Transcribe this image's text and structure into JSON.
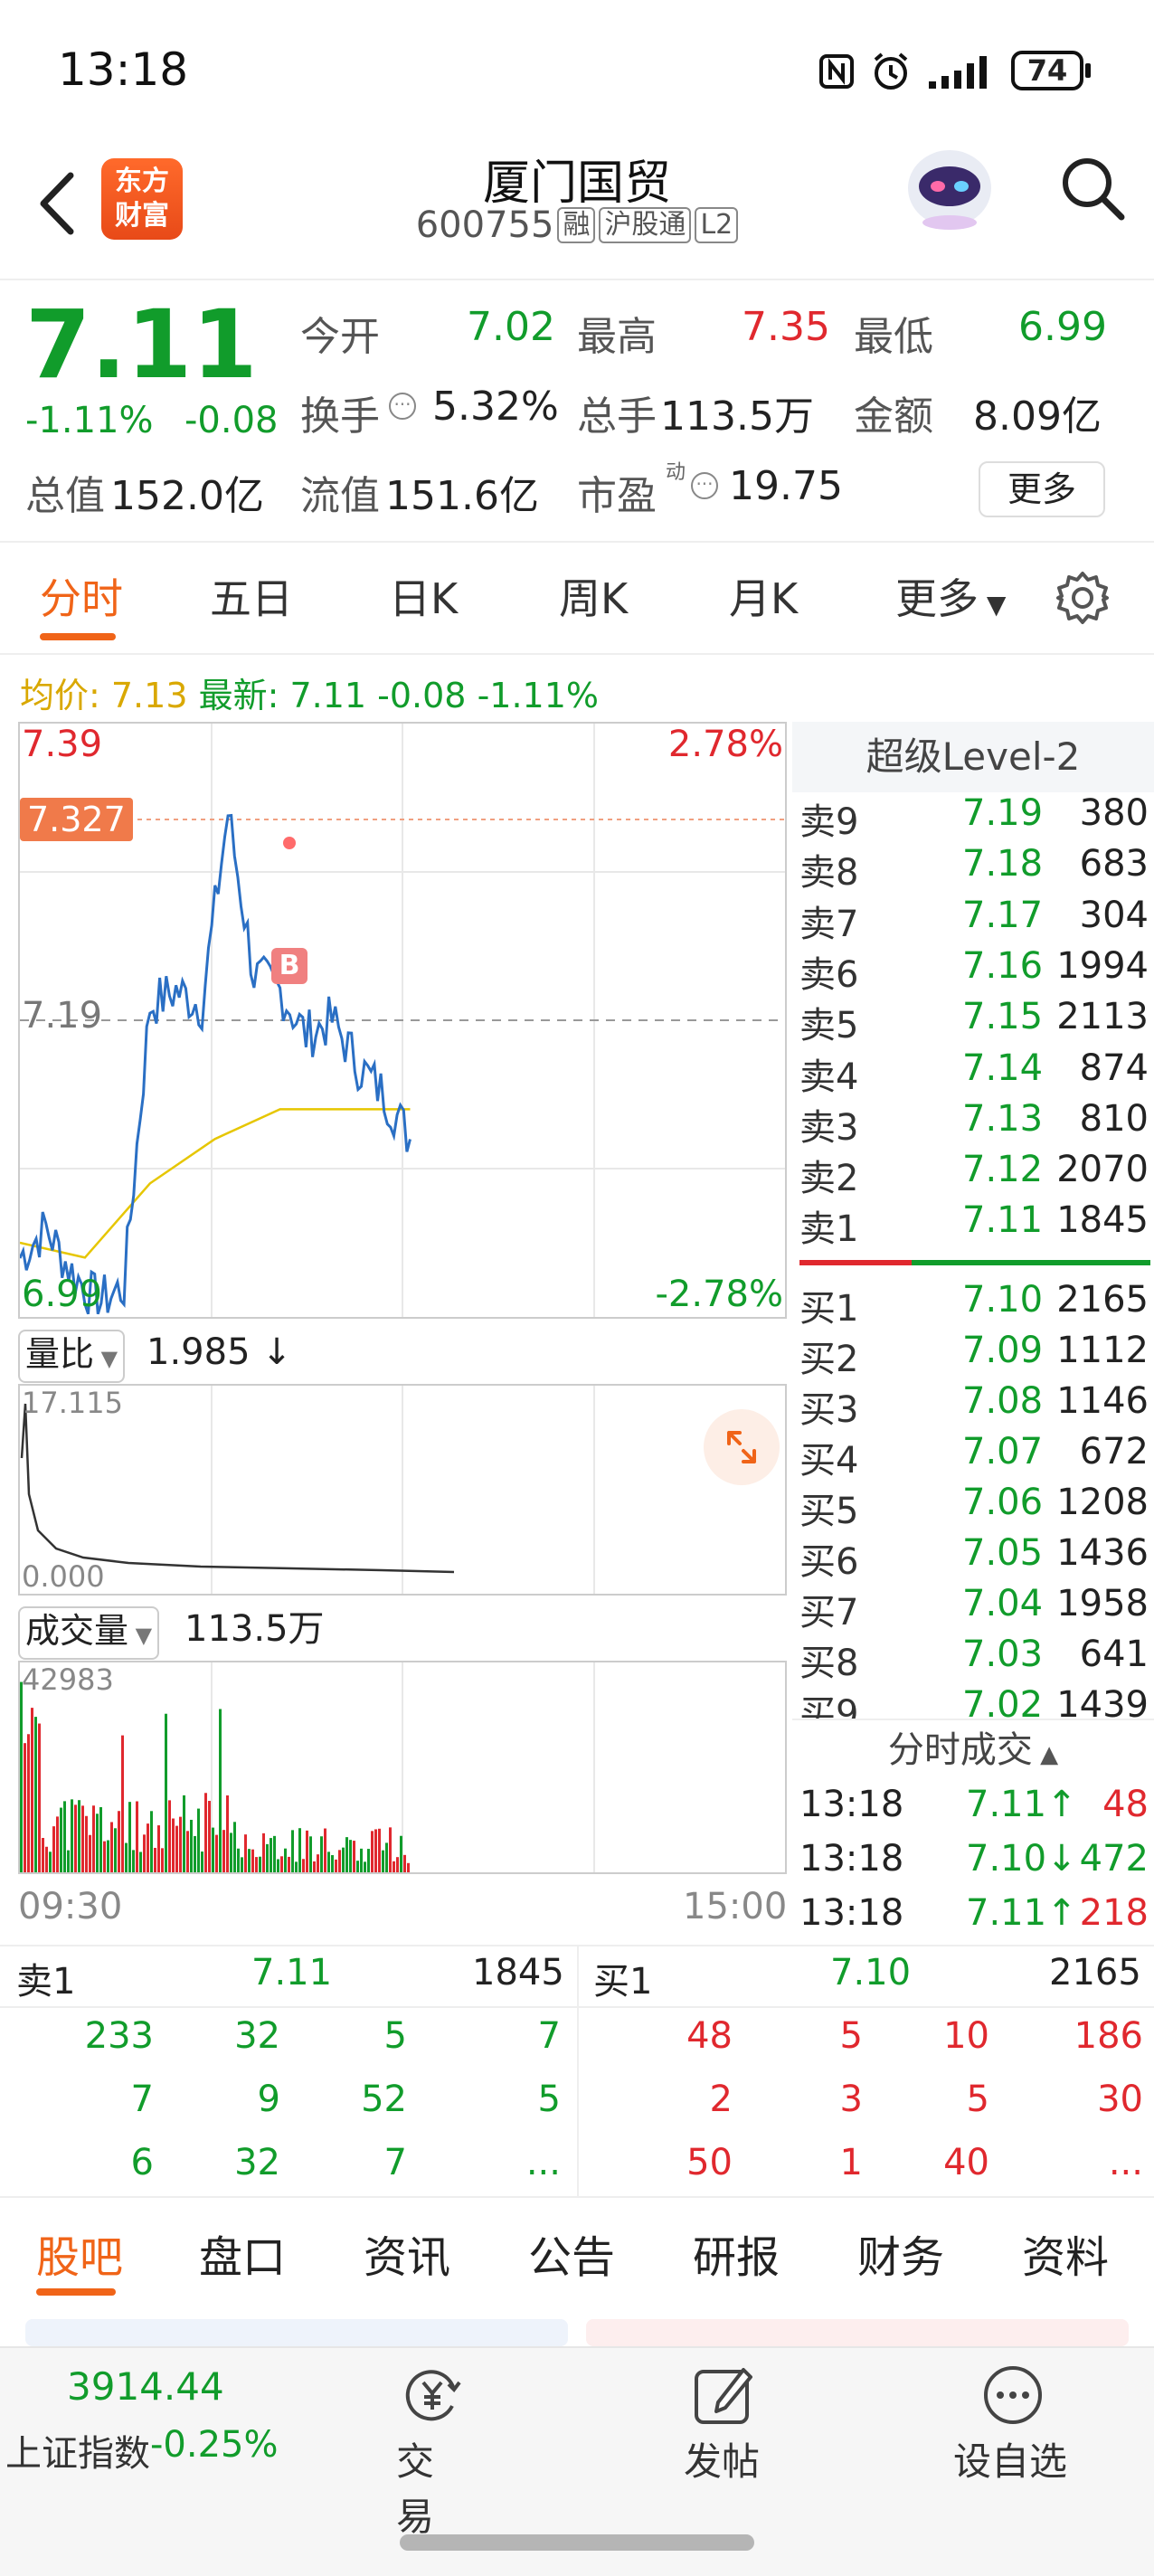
{
  "status_bar": {
    "time": "13:18",
    "battery": "74"
  },
  "header": {
    "app_logo_line1": "东方",
    "app_logo_line2": "财富",
    "stock_name": "厦门国贸",
    "stock_code": "600755",
    "tags": [
      "融",
      "沪股通",
      "L2"
    ]
  },
  "quote": {
    "price": "7.11",
    "change_pct": "-1.11%",
    "change": "-0.08",
    "open_label": "今开",
    "open": "7.02",
    "high_label": "最高",
    "high": "7.35",
    "low_label": "最低",
    "low": "6.99",
    "turnover_label": "换手",
    "turnover": "5.32%",
    "volume_label": "总手",
    "volume": "113.5万",
    "amount_label": "金额",
    "amount": "8.09亿",
    "mktcap_label": "总值",
    "mktcap": "152.0亿",
    "float_label": "流值",
    "float": "151.6亿",
    "pe_label": "市盈",
    "pe_sup": "动",
    "pe": "19.75",
    "more_btn": "更多"
  },
  "tabs": [
    "分时",
    "五日",
    "日K",
    "周K",
    "月K",
    "更多"
  ],
  "legend": {
    "avg_label": "均价: 7.13",
    "latest_label": "最新: 7.11 -0.08 -1.11%"
  },
  "chart": {
    "y_top": "7.39",
    "y_mid": "7.19",
    "y_bottom": "6.99",
    "pct_top": "2.78%",
    "pct_bottom": "-2.78%",
    "high_marker": "7.327",
    "buy_marker": "B",
    "vol_ratio_label": "量比",
    "vol_ratio_value": "1.985 ↓",
    "vol_ratio_max": "17.115",
    "vol_ratio_min": "0.000",
    "volume_label": "成交量",
    "volume_value": "113.5万",
    "volume_max": "42983",
    "time_start": "09:30",
    "time_end": "15:00"
  },
  "chart_data": {
    "type": "line",
    "title": "",
    "series": [
      {
        "name": "",
        "description": "price",
        "x": [
          "09:30",
          "09:40",
          "09:50",
          "10:00",
          "10:10",
          "10:20",
          "10:30",
          "10:40",
          "10:50",
          "11:00",
          "11:10",
          "11:20",
          "11:30",
          "13:00",
          "13:10",
          "13:18"
        ],
        "values": [
          7.03,
          7.05,
          7.02,
          7.0,
          7.01,
          7.2,
          7.21,
          7.2,
          7.33,
          7.22,
          7.21,
          7.18,
          7.19,
          7.16,
          7.14,
          7.11
        ]
      },
      {
        "name": "",
        "description": "average price",
        "x": [
          "09:30",
          "10:00",
          "10:30",
          "11:00",
          "11:30",
          "13:00",
          "13:18"
        ],
        "values": [
          7.04,
          7.03,
          7.08,
          7.11,
          7.13,
          7.13,
          7.13
        ]
      }
    ],
    "ylim": [
      6.99,
      7.39
    ],
    "xlabel": "",
    "ylabel": ""
  },
  "order_book": {
    "title": "超级Level-2",
    "asks": [
      {
        "label": "卖9",
        "price": "7.19",
        "vol": "380"
      },
      {
        "label": "卖8",
        "price": "7.18",
        "vol": "683"
      },
      {
        "label": "卖7",
        "price": "7.17",
        "vol": "304"
      },
      {
        "label": "卖6",
        "price": "7.16",
        "vol": "1994"
      },
      {
        "label": "卖5",
        "price": "7.15",
        "vol": "2113"
      },
      {
        "label": "卖4",
        "price": "7.14",
        "vol": "874"
      },
      {
        "label": "卖3",
        "price": "7.13",
        "vol": "810"
      },
      {
        "label": "卖2",
        "price": "7.12",
        "vol": "2070"
      },
      {
        "label": "卖1",
        "price": "7.11",
        "vol": "1845"
      }
    ],
    "bids": [
      {
        "label": "买1",
        "price": "7.10",
        "vol": "2165"
      },
      {
        "label": "买2",
        "price": "7.09",
        "vol": "1112"
      },
      {
        "label": "买3",
        "price": "7.08",
        "vol": "1146"
      },
      {
        "label": "买4",
        "price": "7.07",
        "vol": "672"
      },
      {
        "label": "买5",
        "price": "7.06",
        "vol": "1208"
      },
      {
        "label": "买6",
        "price": "7.05",
        "vol": "1436"
      },
      {
        "label": "买7",
        "price": "7.04",
        "vol": "1958"
      },
      {
        "label": "买8",
        "price": "7.03",
        "vol": "641"
      },
      {
        "label": "买9",
        "price": "7.02",
        "vol": "1439"
      }
    ],
    "ticks_title": "分时成交",
    "ticks": [
      {
        "time": "13:18",
        "price": "7.11↑",
        "vol": "48",
        "dir": "up"
      },
      {
        "time": "13:18",
        "price": "7.10↓",
        "vol": "472",
        "dir": "down"
      },
      {
        "time": "13:18",
        "price": "7.11↑",
        "vol": "218",
        "dir": "up"
      }
    ]
  },
  "queue": {
    "sell_label": "卖1",
    "sell_price": "7.11",
    "sell_vol": "1845",
    "buy_label": "买1",
    "buy_price": "7.10",
    "buy_vol": "2165",
    "sell_rows": [
      [
        "233",
        "32",
        "5",
        "7"
      ],
      [
        "7",
        "9",
        "52",
        "5"
      ],
      [
        "6",
        "32",
        "7",
        "..."
      ]
    ],
    "buy_rows": [
      [
        "48",
        "5",
        "10",
        "186"
      ],
      [
        "2",
        "3",
        "5",
        "30"
      ],
      [
        "50",
        "1",
        "40",
        "..."
      ]
    ]
  },
  "bottom_tabs": [
    "股吧",
    "盘口",
    "资讯",
    "公告",
    "研报",
    "财务",
    "资料"
  ],
  "bottom_bar": {
    "index_value": "3914.44",
    "index_name": "上证指数",
    "index_change": "-0.25%",
    "trade_label": "交易",
    "post_label": "发帖",
    "watch_label": "设自选"
  }
}
